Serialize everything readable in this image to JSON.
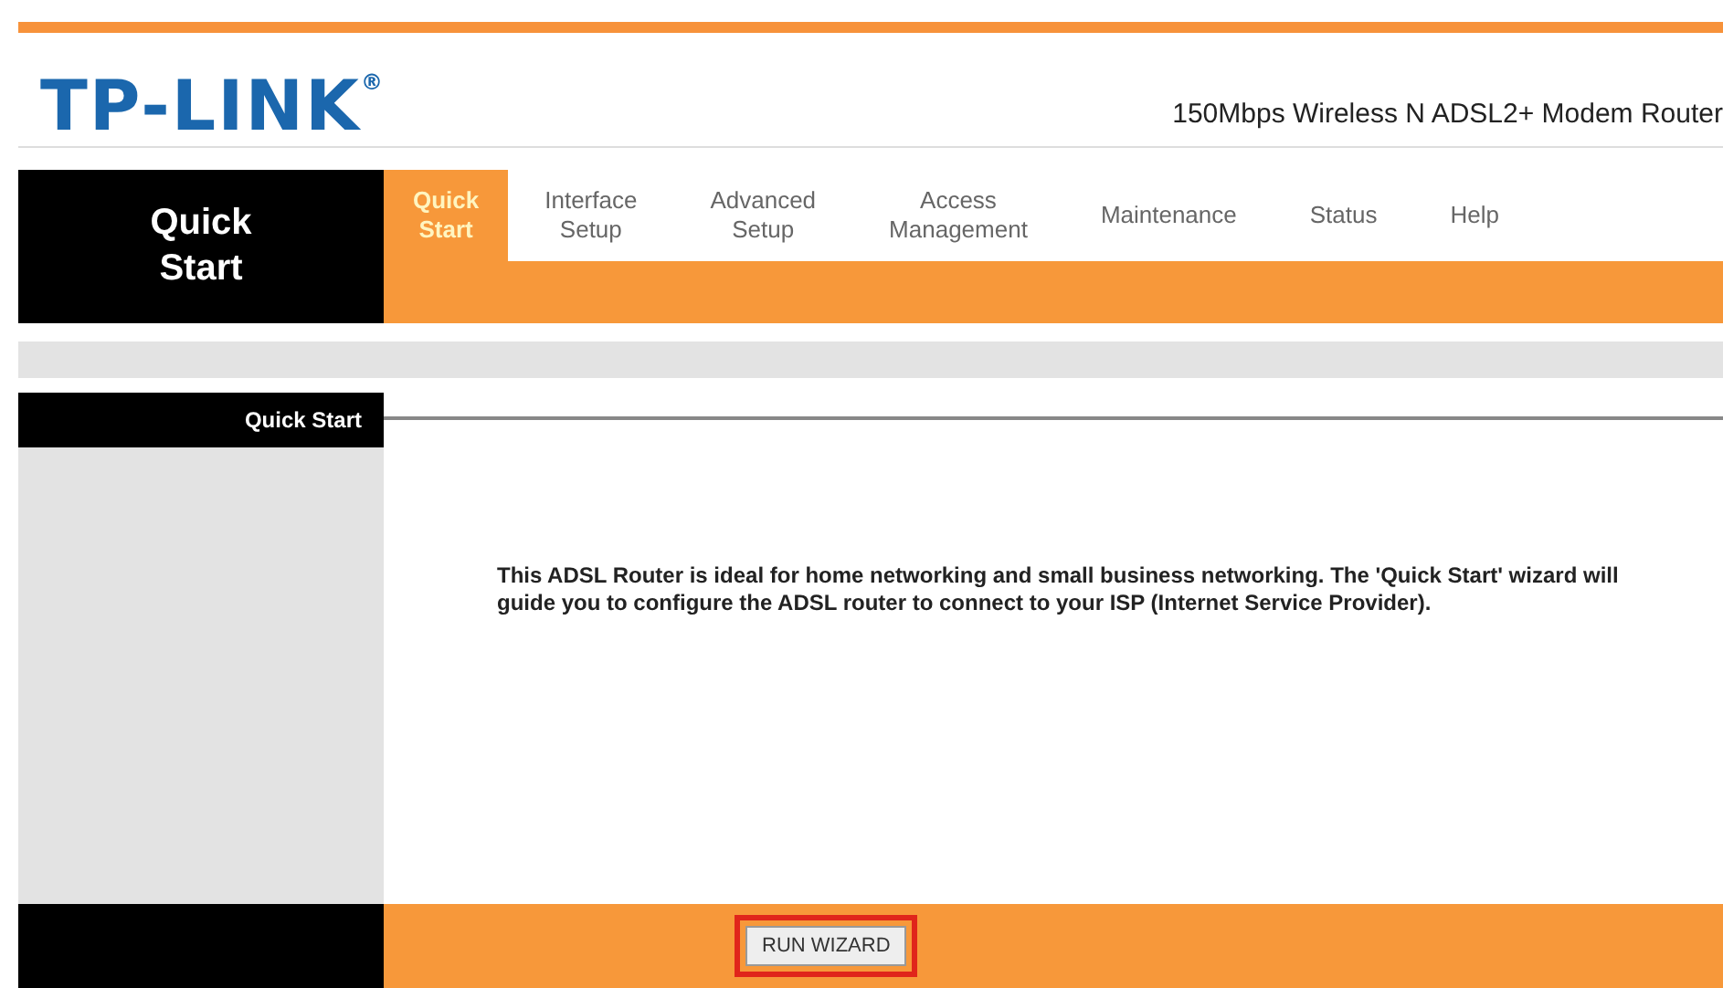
{
  "header": {
    "logo": "TP-LINK",
    "logo_mark": "®",
    "model": "150Mbps Wireless N ADSL2+ Modem Router"
  },
  "section_title": "Quick\nStart",
  "tabs": [
    {
      "label": "Quick\nStart",
      "selected": true
    },
    {
      "label": "Interface\nSetup",
      "selected": false
    },
    {
      "label": "Advanced\nSetup",
      "selected": false
    },
    {
      "label": "Access\nManagement",
      "selected": false
    },
    {
      "label": "Maintenance",
      "selected": false
    },
    {
      "label": "Status",
      "selected": false
    },
    {
      "label": "Help",
      "selected": false
    }
  ],
  "panel": {
    "label": "Quick Start",
    "description": "This ADSL Router is ideal for home networking and small business networking. The 'Quick Start' wizard will guide you to configure the ADSL router to connect to your ISP (Internet Service Provider)."
  },
  "footer": {
    "button": "RUN WIZARD",
    "highlighted": true
  }
}
